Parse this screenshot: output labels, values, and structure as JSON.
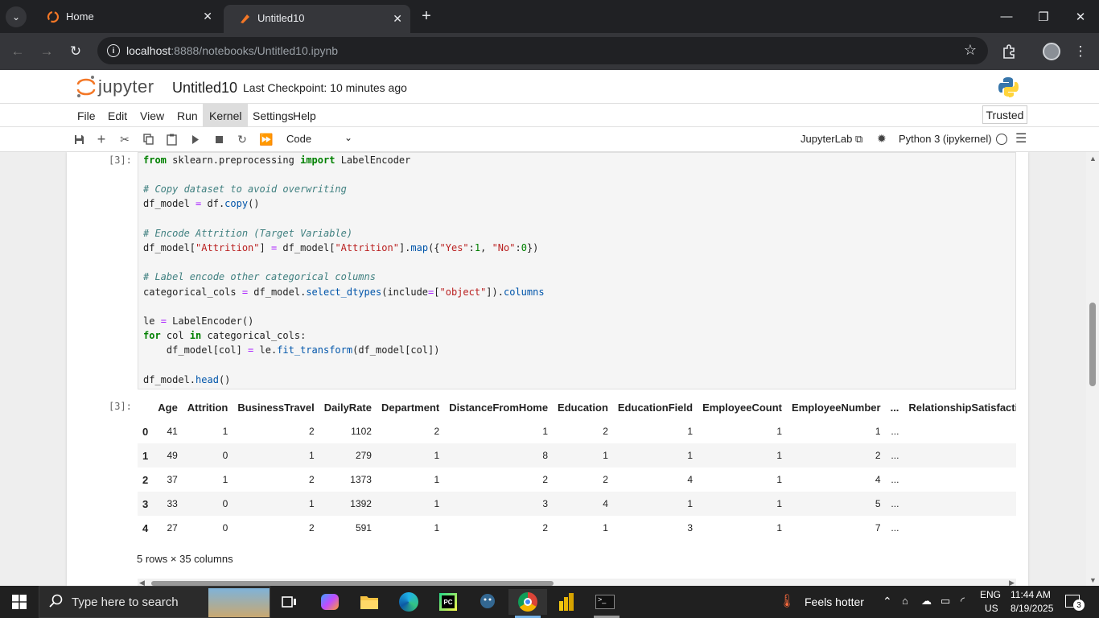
{
  "browser": {
    "tabs": [
      {
        "label": "Home"
      },
      {
        "label": "Untitled10"
      }
    ],
    "url_host": "localhost",
    "url_rest": ":8888/notebooks/Untitled10.ipynb"
  },
  "jupyter": {
    "logo_text": "jupyter",
    "notebook_title": "Untitled10",
    "checkpoint": "Last Checkpoint: 10 minutes ago",
    "menus": [
      "File",
      "Edit",
      "View",
      "Run",
      "Kernel",
      "Settings",
      "Help"
    ],
    "trusted": "Trusted",
    "cell_type": "Code",
    "jupyterlab_link": "JupyterLab",
    "kernel_name": "Python 3 (ipykernel)"
  },
  "cell": {
    "input_prompt": "[3]:",
    "output_prompt": "[3]:",
    "code": {
      "import_from": "from",
      "import_module": "sklearn.preprocessing",
      "import_kw": "import",
      "import_name": "LabelEncoder",
      "comment1": "# Copy dataset to avoid overwriting",
      "comment2": "# Encode Attrition (Target Variable)",
      "comment3": "# Label encode other categorical columns"
    }
  },
  "output_table": {
    "columns": [
      "Age",
      "Attrition",
      "BusinessTravel",
      "DailyRate",
      "Department",
      "DistanceFromHome",
      "Education",
      "EducationField",
      "EmployeeCount",
      "EmployeeNumber",
      "...",
      "RelationshipSatisfactio"
    ],
    "rows": [
      {
        "index": "0",
        "cells": [
          "41",
          "1",
          "2",
          "1102",
          "2",
          "1",
          "2",
          "1",
          "1",
          "1",
          "..."
        ]
      },
      {
        "index": "1",
        "cells": [
          "49",
          "0",
          "1",
          "279",
          "1",
          "8",
          "1",
          "1",
          "1",
          "2",
          "..."
        ]
      },
      {
        "index": "2",
        "cells": [
          "37",
          "1",
          "2",
          "1373",
          "1",
          "2",
          "2",
          "4",
          "1",
          "4",
          "..."
        ]
      },
      {
        "index": "3",
        "cells": [
          "33",
          "0",
          "1",
          "1392",
          "1",
          "3",
          "4",
          "1",
          "1",
          "5",
          "..."
        ]
      },
      {
        "index": "4",
        "cells": [
          "27",
          "0",
          "2",
          "591",
          "1",
          "2",
          "1",
          "3",
          "1",
          "7",
          "..."
        ]
      }
    ],
    "summary": "5 rows × 35 columns"
  },
  "taskbar": {
    "search_placeholder": "Type here to search",
    "weather": "Feels hotter",
    "lang": "ENG",
    "region": "US",
    "time": "11:44 AM",
    "date": "8/19/2025",
    "notifications": "3"
  },
  "colors": {
    "jupyter_orange": "#f37726",
    "code_keyword": "#008000",
    "code_comment": "#408080",
    "code_string": "#ba2121"
  }
}
